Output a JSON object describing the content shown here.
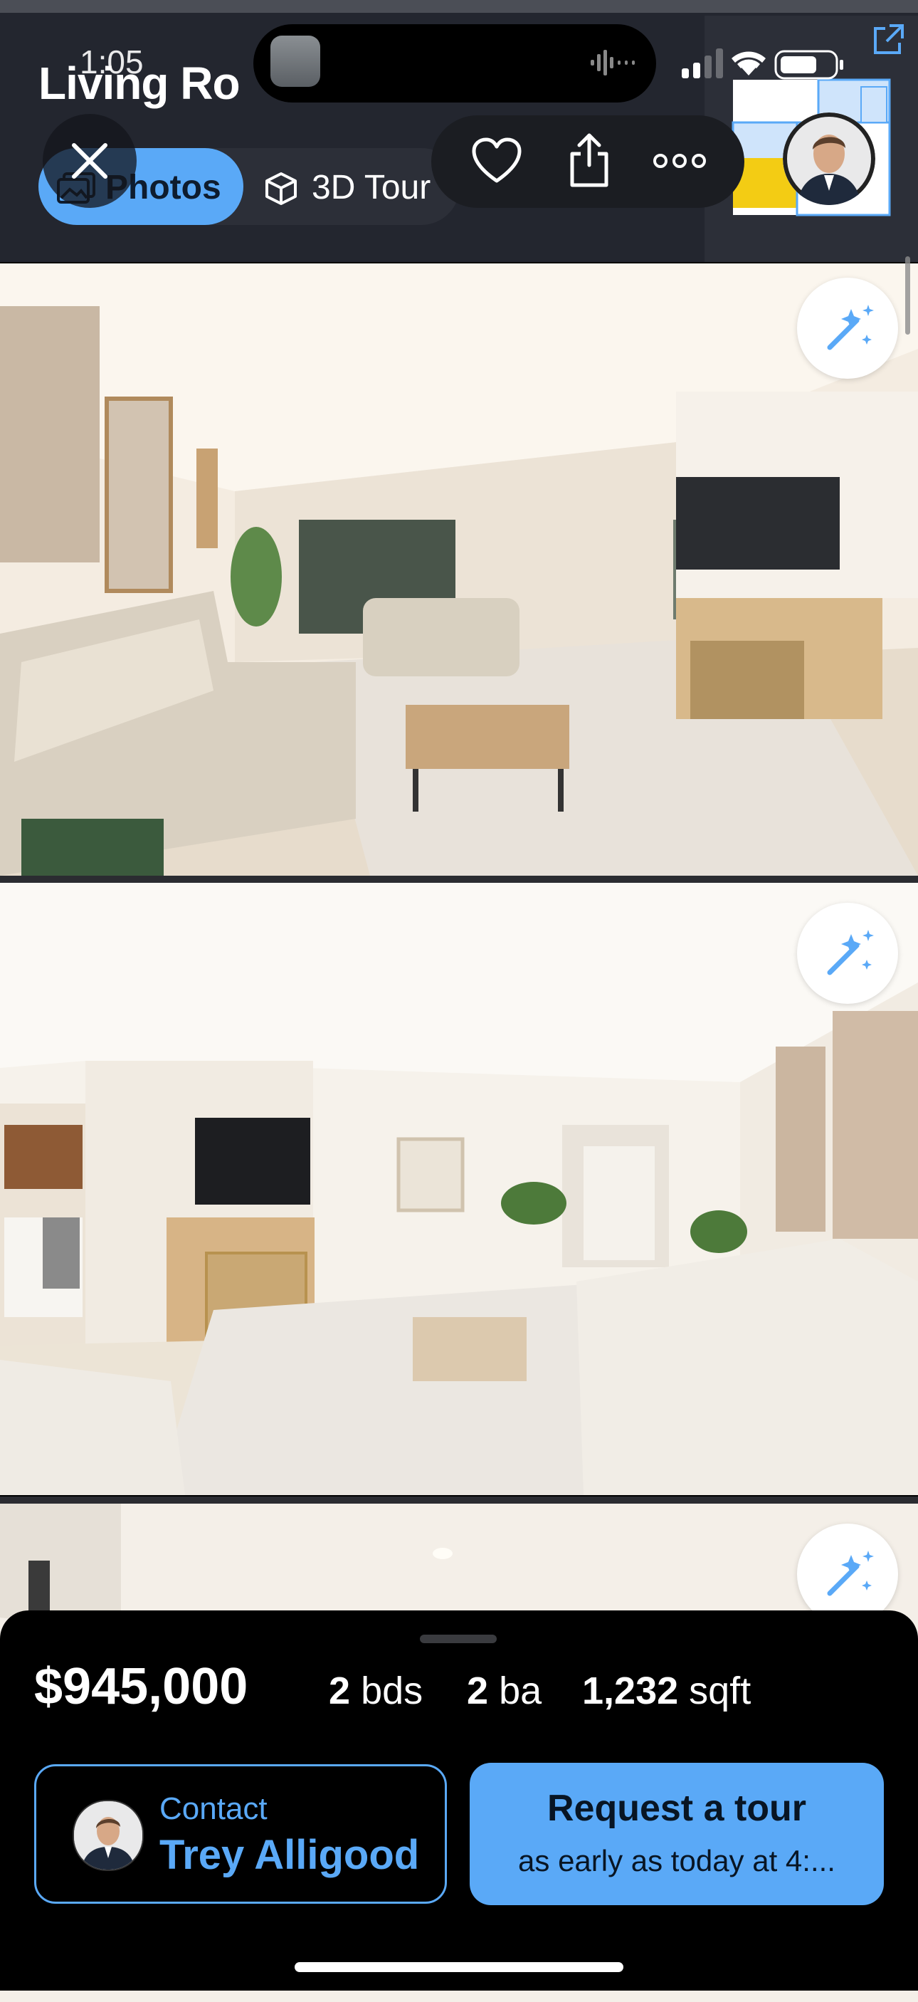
{
  "status_bar": {
    "time": "1:05"
  },
  "header": {
    "title": "Living Ro",
    "tabs": [
      {
        "label": "Photos",
        "icon": "photos-icon",
        "selected": true
      },
      {
        "label": "3D Tour",
        "icon": "cube-icon",
        "selected": false
      }
    ],
    "actions": [
      "heart-icon",
      "share-icon",
      "more-icon"
    ]
  },
  "photos": [
    {
      "name": "living-room-photo-1"
    },
    {
      "name": "living-room-photo-2"
    },
    {
      "name": "living-room-photo-3"
    }
  ],
  "listing": {
    "price": "$945,000",
    "beds_value": "2",
    "beds_unit": "bds",
    "baths_value": "2",
    "baths_unit": "ba",
    "sqft_value": "1,232",
    "sqft_unit": "sqft"
  },
  "contact": {
    "label": "Contact",
    "name": "Trey Alligood"
  },
  "tour": {
    "title": "Request a tour",
    "subtitle": "as early as today at 4:..."
  },
  "colors": {
    "accent": "#5aa9f7",
    "header_bg": "#23262f",
    "sheet_bg": "#000000"
  }
}
